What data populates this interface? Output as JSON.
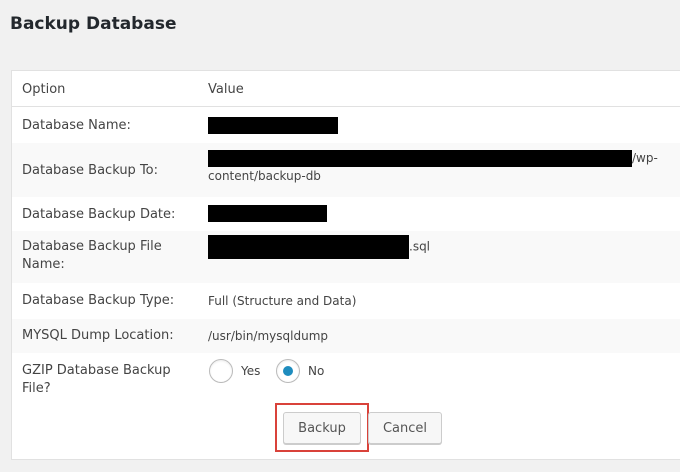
{
  "page": {
    "title": "Backup Database"
  },
  "table": {
    "header": {
      "option": "Option",
      "value": "Value"
    },
    "rows": {
      "name": {
        "label": "Database Name:"
      },
      "backup_to": {
        "label": "Database Backup To:",
        "suffix_line1": "/wp-",
        "suffix_line2": "content/backup-db"
      },
      "date": {
        "label": "Database Backup Date:"
      },
      "file_name": {
        "label_line1": "Database Backup File",
        "label_line2": "Name:",
        "suffix": ".sql"
      },
      "type": {
        "label": "Database Backup Type:",
        "value": "Full (Structure and Data)"
      },
      "dump": {
        "label": "MYSQL Dump Location:",
        "value": "/usr/bin/mysqldump"
      },
      "gzip": {
        "label_line1": "GZIP Database Backup",
        "label_line2": "File?",
        "yes": "Yes",
        "no": "No",
        "selected": "No"
      }
    }
  },
  "buttons": {
    "backup": "Backup",
    "cancel": "Cancel"
  },
  "colors": {
    "accent": "#1e8cbe",
    "highlight": "#d9423a"
  }
}
